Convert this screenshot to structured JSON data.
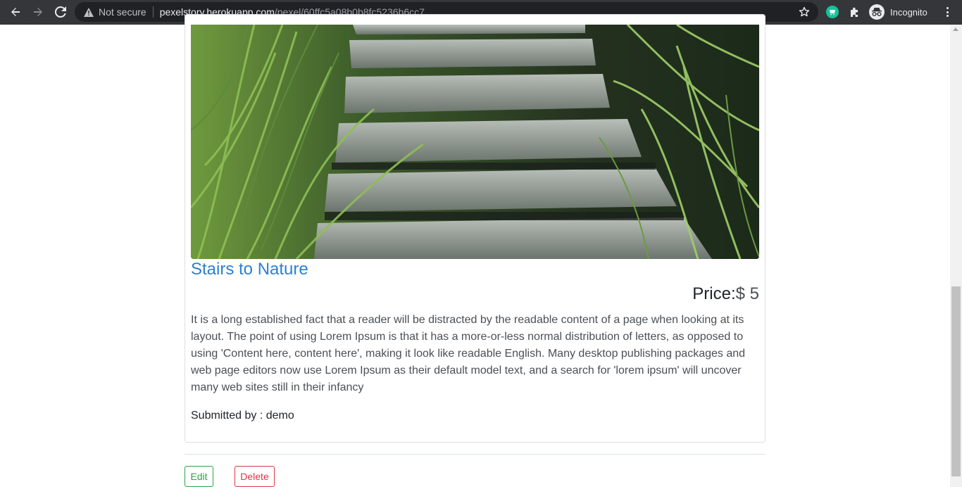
{
  "browser": {
    "security_label": "Not secure",
    "url_host": "pexelstory.herokuapp.com",
    "url_path": "/pexel/60ffc5a08b0b8fc5236b6cc7",
    "profile_label": "Incognito",
    "icons": [
      "back-arrow-icon",
      "forward-arrow-icon",
      "reload-icon",
      "warning-icon",
      "star-icon",
      "grammarly-icon",
      "puzzle-icon",
      "incognito-icon",
      "kebab-menu-icon"
    ]
  },
  "post": {
    "title": "Stairs to Nature",
    "price_label": "Price:",
    "price_value": "$ 5",
    "description": "It is a long established fact that a reader will be distracted by the readable content of a page when looking at its layout. The point of using Lorem Ipsum is that it has a more-or-less normal distribution of letters, as opposed to using 'Content here, content here', making it look like readable English. Many desktop publishing packages and web page editors now use Lorem Ipsum as their default model text, and a search for 'lorem ipsum' will uncover many web sites still in their infancy",
    "submitted_by": "Submitted by : demo"
  },
  "actions": {
    "edit_label": "Edit",
    "delete_label": "Delete"
  },
  "colors": {
    "title_link": "#2c7fd4",
    "edit_button": "#28a745",
    "delete_button": "#dc3545",
    "chrome_bg": "#35363a"
  }
}
